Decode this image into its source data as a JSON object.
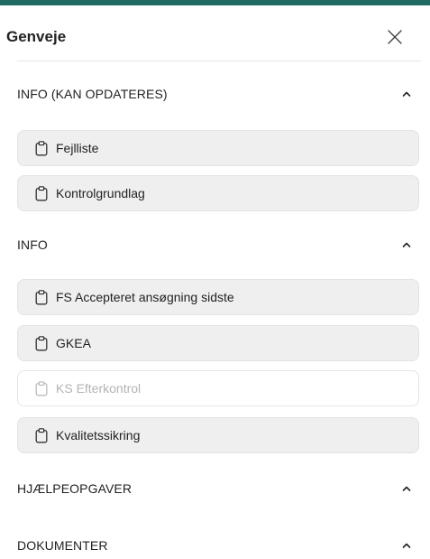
{
  "panel": {
    "title": "Genveje",
    "close_icon": "close-icon"
  },
  "sections": [
    {
      "label": "INFO (KAN OPDATERES)",
      "expanded": true,
      "items": [
        {
          "label": "Fejlliste",
          "icon": "clipboard-icon",
          "disabled": false
        },
        {
          "label": "Kontrolgrundlag",
          "icon": "clipboard-icon",
          "disabled": false
        }
      ]
    },
    {
      "label": "INFO",
      "expanded": true,
      "items": [
        {
          "label": "FS Accepteret ansøgning sidste",
          "icon": "clipboard-icon",
          "disabled": false
        },
        {
          "label": "GKEA",
          "icon": "clipboard-icon",
          "disabled": false
        },
        {
          "label": "KS Efterkontrol",
          "icon": "clipboard-icon",
          "disabled": true
        },
        {
          "label": "Kvalitetssikring",
          "icon": "clipboard-icon",
          "disabled": false
        }
      ]
    },
    {
      "label": "HJÆLPEOPGAVER",
      "expanded": false,
      "items": []
    },
    {
      "label": "DOKUMENTER",
      "expanded": false,
      "items": []
    }
  ],
  "colors": {
    "accent_bar": "#1f6b63",
    "item_bg": "#efefef",
    "disabled_text": "#b3b3b3"
  }
}
